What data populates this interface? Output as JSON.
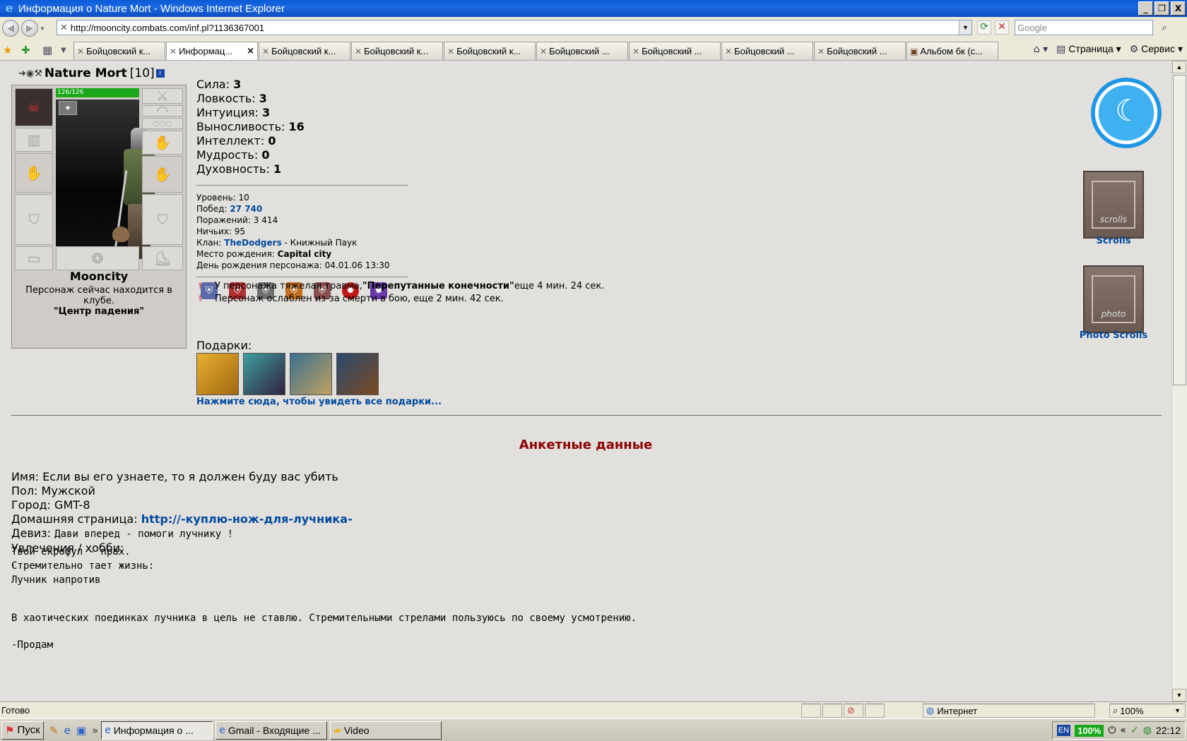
{
  "window": {
    "title": "Информация о Nature Mort - Windows Internet Explorer",
    "min": "_",
    "restore": "❐",
    "close": "X"
  },
  "address": {
    "url": "http://mooncity.combats.com/inf.pl?1136367001",
    "search_placeholder": "Google"
  },
  "tabs": [
    {
      "label": "Бойцовский к..."
    },
    {
      "label": "Информац..."
    },
    {
      "label": "Бойцовский к..."
    },
    {
      "label": "Бойцовский к..."
    },
    {
      "label": "Бойцовский к..."
    },
    {
      "label": "Бойцовский ..."
    },
    {
      "label": "Бойцовский ..."
    },
    {
      "label": "Бойцовский ..."
    },
    {
      "label": "Бойцовский ..."
    },
    {
      "label": "Альбом бк (с..."
    }
  ],
  "commandbar": {
    "page": "Страница",
    "tools": "Сервис"
  },
  "character": {
    "name": "Nature Mort",
    "level": "[10]",
    "hp": "126/126",
    "location_city": "Mooncity",
    "location_text": "Персонаж сейчас находится в клубе.",
    "location_club": "\"Центр падения\""
  },
  "stats": [
    {
      "label": "Сила:",
      "value": "3"
    },
    {
      "label": "Ловкость:",
      "value": "3"
    },
    {
      "label": "Интуиция:",
      "value": "3"
    },
    {
      "label": "Выносливость:",
      "value": "16"
    },
    {
      "label": "Интеллект:",
      "value": "0"
    },
    {
      "label": "Мудрость:",
      "value": "0"
    },
    {
      "label": "Духовность:",
      "value": "1"
    }
  ],
  "info": {
    "level_label": "Уровень:",
    "level_value": "10",
    "wins_label": "Побед:",
    "wins_value": "27 740",
    "losses_label": "Поражений:",
    "losses_value": "3 414",
    "draws_label": "Ничьих:",
    "draws_value": "95",
    "clan_label": "Клан:",
    "clan_value": "TheDodgers",
    "clan_rank": " - Книжный Паук",
    "birthplace_label": "Место рождения:",
    "birthplace_value": "Capital city",
    "birthday_label": "День рождения персонажа:",
    "birthday_value": "04.01.06 13:30"
  },
  "effects": [
    {
      "prefix": "У персонажа тяжелая травма, ",
      "bold": "\"Перепутанные конечности\"",
      "suffix": " еще 4 мин. 24 сек."
    },
    {
      "prefix": "Персонаж ослаблен из-за смерти в бою, еще 2 мин. 42 сек.",
      "bold": "",
      "suffix": ""
    }
  ],
  "gifts": {
    "label": "Подарки:",
    "link": "Нажмите сюда, чтобы увидеть все подарки..."
  },
  "profile": {
    "section_title": "Анкетные данные",
    "name_label": "Имя:",
    "name_value": "Если вы его узнаете, то я должен буду вас убить",
    "sex_label": "Пол:",
    "sex_value": "Мужской",
    "city_label": "Город:",
    "city_value": "GMT-8",
    "home_label": "Домашняя страница:",
    "home_value": "http://-куплю-нож-для-лучника-",
    "motto_label": "Девиз:",
    "motto_value": "Дави вперед - помоги лучнику !",
    "hobby_label": "Увлечения / хобби:",
    "dot": ".",
    "poem1": "Твой екрофул - прах.",
    "poem2": "Стремительно тает жизнь:",
    "poem3": "Лучник напротив",
    "prose": "В хаотических поединках лучника в цель не ставлю. Стремительными стрелами пользуюсь по своему усмотрению.",
    "sell": "-Продам"
  },
  "side": {
    "scrolls": "Scrolls",
    "photo_scrolls": "Photo Scrolls",
    "scroll_word": "scrolls",
    "photo_word": "photo"
  },
  "status": {
    "text": "Готово",
    "zone": "Интернет",
    "zoom": "100%"
  },
  "taskbar": {
    "start": "Пуск",
    "tasks": [
      {
        "label": "Информация о ..."
      },
      {
        "label": "Gmail - Входящие ..."
      },
      {
        "label": "Video"
      }
    ],
    "lang": "EN",
    "battery": "100%",
    "clock": "22:12"
  }
}
